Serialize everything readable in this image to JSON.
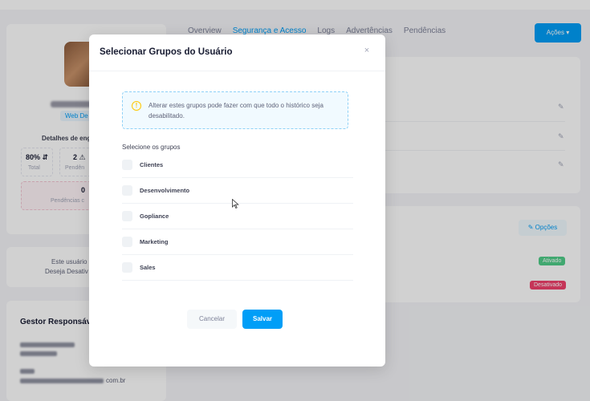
{
  "background": {
    "tabs": [
      "Overview",
      "Segurança e Acesso",
      "Logs",
      "Advertências",
      "Pendências"
    ],
    "active_tab_index": 1,
    "actions_button": "Ações ▾",
    "profile": {
      "role_badge": "Web De",
      "details_label": "Detalhes de eng",
      "stat_1_value": "80% ⇵",
      "stat_1_label": "Total",
      "stat_2_value": "2 ⚠",
      "stat_2_label": "Pendên",
      "pending_value": "0",
      "pending_label": "Pendências c"
    },
    "deactivate": {
      "line_1": "Este usuário",
      "line_2": "Deseja Desativ"
    },
    "gestor": {
      "title": "Gestor Responsáv",
      "email_fragment": "com.br"
    },
    "options_button": "Opções",
    "badge_active": "Ativado",
    "badge_inactive": "Desativado"
  },
  "modal": {
    "title": "Selecionar Grupos do Usuário",
    "close_symbol": "×",
    "notice_icon": "!",
    "notice_text": "Alterar estes grupos pode fazer com que todo o histórico seja desabilitado.",
    "groups_label": "Selecione os grupos",
    "groups": [
      {
        "name": "Clientes",
        "checked": false
      },
      {
        "name": "Desenvolvimento",
        "checked": false
      },
      {
        "name": "Gopliance",
        "checked": false
      },
      {
        "name": "Marketing",
        "checked": false
      },
      {
        "name": "Sales",
        "checked": false
      }
    ],
    "cancel_label": "Cancelar",
    "save_label": "Salvar"
  },
  "colors": {
    "primary": "#009ef7",
    "success": "#50cd89",
    "danger": "#f1416c",
    "warning": "#ffc700"
  }
}
